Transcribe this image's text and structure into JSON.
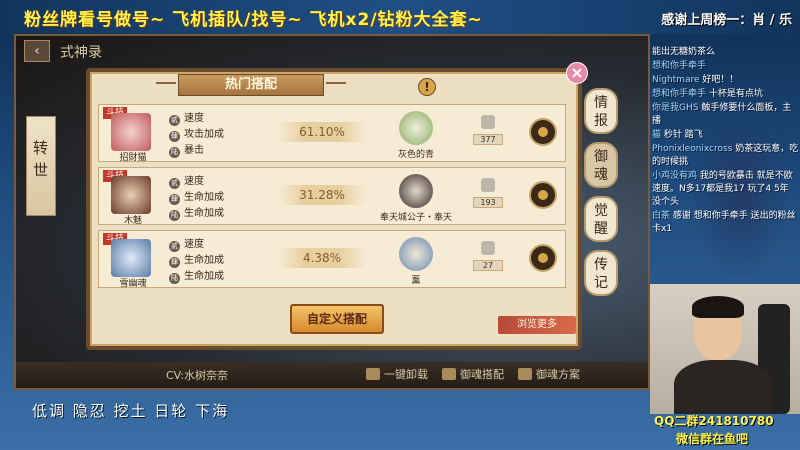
{
  "banner": {
    "title": "粉丝牌看号做号~ 飞机插队/找号~ 飞机x2/钻粉大全套~",
    "thanks": "感谢上周榜一：肖 / 乐"
  },
  "game": {
    "title": "式神录",
    "left_tab": "转世",
    "side_tabs": [
      "情报",
      "御魂",
      "觉醒",
      "传记"
    ],
    "panel_title": "热门搭配",
    "cv": "CV:水树奈奈",
    "bottom_actions": [
      "一键卸载",
      "御魂搭配",
      "御魂方案"
    ],
    "rows": [
      {
        "tag": "斗技",
        "shikigami": "招財猫",
        "attrs": [
          "速度",
          "攻击加成",
          "暴击"
        ],
        "percent": "61.10%",
        "soul": "灰色的青",
        "likes": "377"
      },
      {
        "tag": "斗技",
        "shikigami": "木魅",
        "attrs": [
          "速度",
          "生命加成",
          "生命加成"
        ],
        "percent": "31.28%",
        "soul": "奉天城公子・奉天",
        "likes": "193"
      },
      {
        "tag": "斗技",
        "shikigami": "雪幽魂",
        "attrs": [
          "速度",
          "生命加成",
          "生命加成"
        ],
        "percent": "4.38%",
        "soul": "薰",
        "likes": "27"
      }
    ],
    "custom_button": "自定义搭配",
    "browse_button": "浏览更多"
  },
  "chat": [
    {
      "user": "",
      "text": "能出无糖奶茶么"
    },
    {
      "user": "想和你手牵手",
      "text": ""
    },
    {
      "user": "Nightmare",
      "text": "好吧！！"
    },
    {
      "user": "想和你手牵手",
      "text": "十杯是有点坑"
    },
    {
      "user": "你是我GHS",
      "text": "触手修要什么面板，主播"
    },
    {
      "user": "猫",
      "text": "秒针 踏飞"
    },
    {
      "user": "Phonixleonixcross",
      "text": "奶茶这玩意，吃的时候挑"
    },
    {
      "user": "小鸡没有鸡",
      "text": "我的号欧暴击 就是不欧速度。N多17都是我17 玩了4 5年 没个头"
    },
    {
      "user": "白茶",
      "text": "感谢 想和你手牵手 送出的粉丝卡x1"
    }
  ],
  "stream": {
    "caption": "低调 隐忍 挖土 日轮 下海",
    "qq": "QQ二群241810780",
    "wechat": "微信群在鱼吧"
  }
}
